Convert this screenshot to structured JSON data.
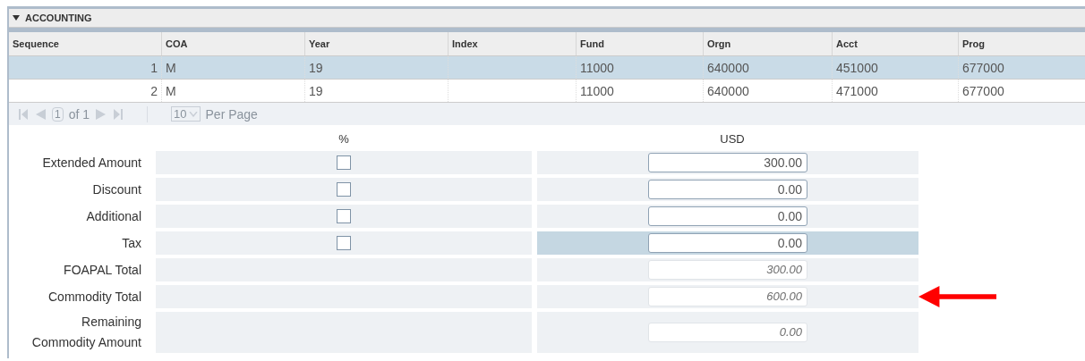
{
  "section": {
    "title": "ACCOUNTING",
    "expanded": true
  },
  "table": {
    "columns": [
      "Sequence",
      "COA",
      "Year",
      "Index",
      "Fund",
      "Orgn",
      "Acct",
      "Prog"
    ],
    "rows": [
      {
        "selected": true,
        "cells": [
          "1",
          "M",
          "19",
          "",
          "11000",
          "640000",
          "451000",
          "677000"
        ]
      },
      {
        "selected": false,
        "cells": [
          "2",
          "M",
          "19",
          "",
          "11000",
          "640000",
          "471000",
          "677000"
        ]
      }
    ]
  },
  "pager": {
    "page": "1",
    "of": "of 1",
    "per_page": "10",
    "per_page_label": "Per Page"
  },
  "form": {
    "percent_header": "%",
    "usd_header": "USD",
    "rows": [
      {
        "label": "Extended Amount",
        "kind": "entry",
        "checked": false,
        "value": "300.00",
        "selected": false,
        "pointer_arrow": false
      },
      {
        "label": "Discount",
        "kind": "entry",
        "checked": false,
        "value": "0.00",
        "selected": false,
        "pointer_arrow": false
      },
      {
        "label": "Additional",
        "kind": "entry",
        "checked": false,
        "value": "0.00",
        "selected": false,
        "pointer_arrow": false
      },
      {
        "label": "Tax",
        "kind": "entry",
        "checked": false,
        "value": "0.00",
        "selected": true,
        "pointer_arrow": false
      },
      {
        "label": "FOAPAL Total",
        "kind": "readonly",
        "value": "300.00",
        "selected": false,
        "pointer_arrow": false
      },
      {
        "label": "Commodity Total",
        "kind": "readonly",
        "value": "600.00",
        "selected": false,
        "pointer_arrow": true
      },
      {
        "label": "Remaining Commodity Amount",
        "kind": "readonly",
        "value": "0.00",
        "selected": false,
        "pointer_arrow": false
      }
    ]
  }
}
